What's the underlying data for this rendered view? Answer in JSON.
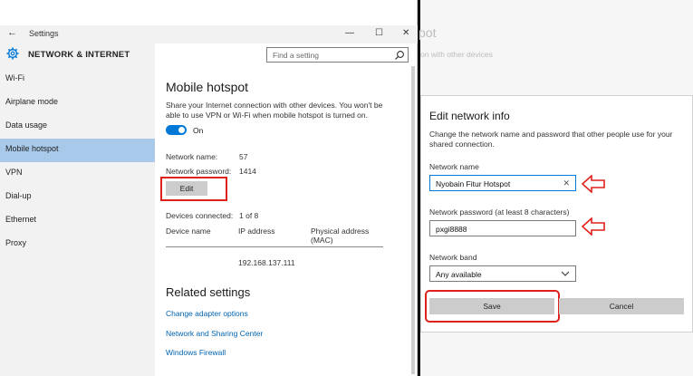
{
  "window": {
    "title": "Settings",
    "back_icon": "back-arrow-icon",
    "controls": [
      "—",
      "☐",
      "✕"
    ]
  },
  "sidebar": {
    "header": "NETWORK & INTERNET",
    "header_icon": "gear-icon",
    "items": [
      {
        "label": "Wi-Fi",
        "active": false
      },
      {
        "label": "Airplane mode",
        "active": false
      },
      {
        "label": "Data usage",
        "active": false
      },
      {
        "label": "Mobile hotspot",
        "active": true
      },
      {
        "label": "VPN",
        "active": false
      },
      {
        "label": "Dial-up",
        "active": false
      },
      {
        "label": "Ethernet",
        "active": false
      },
      {
        "label": "Proxy",
        "active": false
      }
    ]
  },
  "search": {
    "placeholder": "Find a setting",
    "icon": "search-icon"
  },
  "hotspot": {
    "title": "Mobile hotspot",
    "description": "Share your Internet connection with other devices. You won't be able to use VPN or Wi-Fi when mobile hotspot is turned on.",
    "toggle_label": "On",
    "toggle_on": true,
    "network_name_label": "Network name:",
    "network_name": "57",
    "network_password_label": "Network password:",
    "network_password": "1414",
    "edit_label": "Edit",
    "devices_label": "Devices connected:",
    "devices_value": "1 of 8",
    "columns": [
      "Device name",
      "IP address",
      "Physical address (MAC)"
    ],
    "rows": [
      {
        "device": "",
        "ip": "192.168.137.111",
        "mac": ""
      }
    ],
    "related_title": "Related settings",
    "related_links": [
      "Change adapter options",
      "Network and Sharing Center",
      "Windows Firewall"
    ]
  },
  "background": {
    "title": "pot",
    "subtitle": "on with other devices"
  },
  "dialog": {
    "title": "Edit network info",
    "description": "Change the network name and password that other people use for your shared connection.",
    "name_label": "Network name",
    "name_value": "Nyobain Fitur Hotspot",
    "password_label": "Network password (at least 8 characters)",
    "password_value": "pxgi8888",
    "band_label": "Network band",
    "band_value": "Any available",
    "save_label": "Save",
    "cancel_label": "Cancel"
  },
  "annotation_color": "#e0201b",
  "accent_color": "#0078d7"
}
